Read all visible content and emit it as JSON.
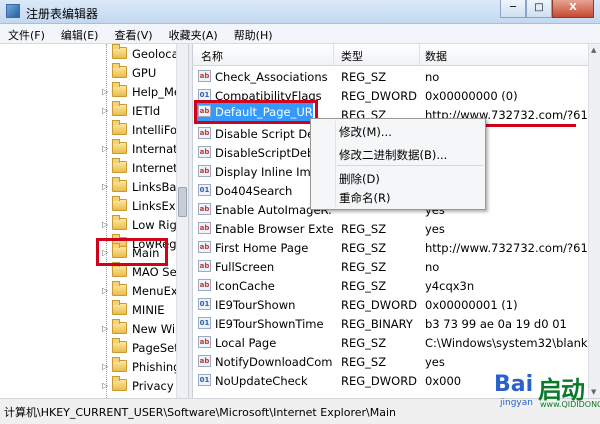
{
  "window": {
    "title": "注册表编辑器",
    "buttons": [
      "─",
      "□",
      "X"
    ]
  },
  "menu": [
    "文件(F)",
    "编辑(E)",
    "查看(V)",
    "收藏夹(A)",
    "帮助(H)"
  ],
  "tree": {
    "items": [
      {
        "label": "Geoloca",
        "expander": ""
      },
      {
        "label": "GPU",
        "expander": ""
      },
      {
        "label": "Help_Me",
        "expander": "▷"
      },
      {
        "label": "IETld",
        "expander": "▷"
      },
      {
        "label": "IntelliFo",
        "expander": ""
      },
      {
        "label": "Internat",
        "expander": "▷"
      },
      {
        "label": "Internet",
        "expander": ""
      },
      {
        "label": "LinksBar",
        "expander": "▷"
      },
      {
        "label": "LinksExp",
        "expander": ""
      },
      {
        "label": "Low Rig",
        "expander": "▷"
      },
      {
        "label": "LowRegi",
        "expander": ""
      },
      {
        "label": "Main",
        "expander": "▷"
      },
      {
        "label": "MAO Se",
        "expander": ""
      },
      {
        "label": "MenuExt",
        "expander": "▷"
      },
      {
        "label": "MINIE",
        "expander": ""
      },
      {
        "label": "New Wi",
        "expander": "▷"
      },
      {
        "label": "PageSet",
        "expander": ""
      },
      {
        "label": "Phishing",
        "expander": "▷"
      },
      {
        "label": "Privacy",
        "expander": "▷"
      }
    ]
  },
  "list": {
    "headers": {
      "name": "名称",
      "type": "类型",
      "data": "数据"
    },
    "rows": [
      {
        "name": "Check_Associations",
        "type": "REG_SZ",
        "data": "no",
        "icon": "ab"
      },
      {
        "name": "CompatibilityFlags",
        "type": "REG_DWORD",
        "data": "0x00000000 (0)",
        "icon": "bin"
      },
      {
        "name": "",
        "type": "REG_SZ",
        "data": "http://www.732732.com/?611",
        "icon": "ab"
      },
      {
        "name": "Disable Script Deb",
        "type": "",
        "data": "",
        "icon": "ab"
      },
      {
        "name": "DisableScriptDebu",
        "type": "",
        "data": "",
        "icon": "ab"
      },
      {
        "name": "Display Inline Ima",
        "type": "",
        "data": "",
        "icon": "ab"
      },
      {
        "name": "Do404Search",
        "type": "",
        "data": "",
        "icon": "bin"
      },
      {
        "name": "Enable AutoImageR...",
        "type": "",
        "data": "yes",
        "icon": "ab"
      },
      {
        "name": "Enable Browser Exte...",
        "type": "REG_SZ",
        "data": "yes",
        "icon": "ab"
      },
      {
        "name": "First Home Page",
        "type": "REG_SZ",
        "data": "http://www.732732.com/?611",
        "icon": "ab"
      },
      {
        "name": "FullScreen",
        "type": "REG_SZ",
        "data": "no",
        "icon": "ab"
      },
      {
        "name": "IconCache",
        "type": "REG_SZ",
        "data": "y4cqx3n",
        "icon": "ab"
      },
      {
        "name": "IE9TourShown",
        "type": "REG_DWORD",
        "data": "0x00000001 (1)",
        "icon": "bin"
      },
      {
        "name": "IE9TourShownTime",
        "type": "REG_BINARY",
        "data": "b3 73 99 ae 0a 19 d0 01",
        "icon": "bin"
      },
      {
        "name": "Local Page",
        "type": "REG_SZ",
        "data": "C:\\Windows\\system32\\blank.",
        "icon": "ab"
      },
      {
        "name": "NotifyDownloadCom...",
        "type": "REG_SZ",
        "data": "yes",
        "icon": "ab"
      },
      {
        "name": "NoUpdateCheck",
        "type": "REG_DWORD",
        "data": "0x000",
        "icon": "bin"
      }
    ]
  },
  "selected": {
    "name": "Default_Page_URL"
  },
  "context_menu": {
    "modify": "修改(M)...",
    "modify_binary": "修改二进制数据(B)...",
    "delete": "删除(D)",
    "rename": "重命名(R)"
  },
  "status": "计算机\\HKEY_CURRENT_USER\\Software\\Microsoft\\Internet Explorer\\Main",
  "watermark": {
    "bai": "Bai",
    "sub": "jingyan",
    "cn": "启动",
    "url": "www.QIDIDONG.COM"
  },
  "colors": {
    "selection": "#3399ff",
    "highlight": "#d0021b"
  }
}
